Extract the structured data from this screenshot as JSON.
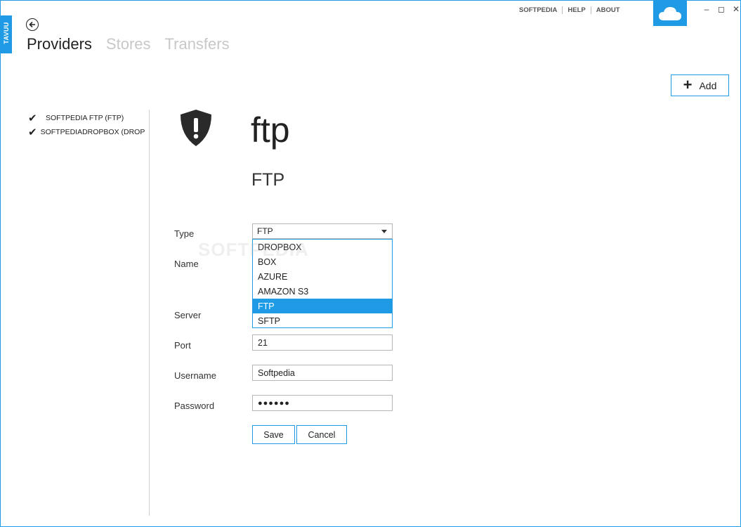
{
  "app": {
    "brand": "TAVUU"
  },
  "top_links": [
    "SOFTPEDIA",
    "HELP",
    "ABOUT"
  ],
  "window_controls": [
    "minimize-icon",
    "maximize-icon",
    "close-icon"
  ],
  "nav": {
    "tabs": [
      {
        "label": "Providers",
        "active": true
      },
      {
        "label": "Stores",
        "active": false
      },
      {
        "label": "Transfers",
        "active": false
      }
    ]
  },
  "add_button": {
    "label": "Add"
  },
  "providers": [
    {
      "label": "SOFTPEDIA FTP (FTP)"
    },
    {
      "label": "SOFTPEDIADROPBOX (DROPBOX)"
    }
  ],
  "detail": {
    "name": "ftp",
    "type": "FTP"
  },
  "form": {
    "type_label": "Type",
    "type_value": "FTP",
    "type_options": [
      "DROPBOX",
      "BOX",
      "AZURE",
      "AMAZON S3",
      "FTP",
      "SFTP"
    ],
    "type_selected_index": 4,
    "name_label": "Name",
    "server_label": "Server",
    "port_label": "Port",
    "port_value": "21",
    "username_label": "Username",
    "username_value": "Softpedia",
    "password_label": "Password",
    "password_value": "●●●●●●"
  },
  "buttons": {
    "save": "Save",
    "cancel": "Cancel"
  },
  "watermark": "SOFTPEDIA",
  "colors": {
    "accent": "#1e9be4"
  }
}
